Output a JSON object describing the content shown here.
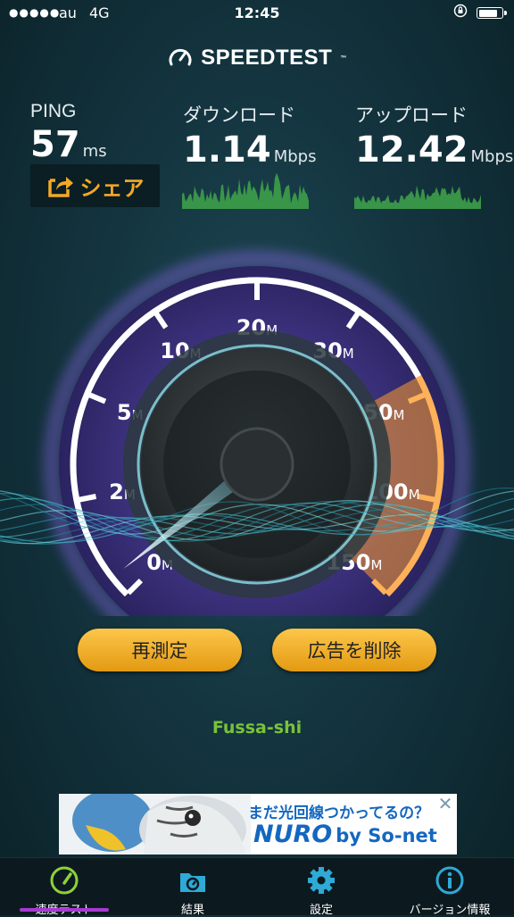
{
  "status_bar": {
    "signal": "●●●●●",
    "carrier": "au",
    "network": "4G",
    "time": "12:45",
    "lock_icon": "orientation-lock-icon",
    "battery_level": 0.8
  },
  "header": {
    "title": "SPEEDTEST",
    "trademark": "™"
  },
  "metrics": {
    "ping": {
      "label": "PING",
      "value": "57",
      "unit": "ms"
    },
    "download": {
      "label": "ダウンロード",
      "value": "1.14",
      "unit": "Mbps"
    },
    "upload": {
      "label": "アップロード",
      "value": "12.42",
      "unit": "Mbps"
    }
  },
  "share_button": {
    "label": "シェア",
    "icon": "share-icon"
  },
  "gauge": {
    "scale_labels": [
      {
        "num": "0",
        "unit": "M"
      },
      {
        "num": "2",
        "unit": "M"
      },
      {
        "num": "5",
        "unit": "M"
      },
      {
        "num": "10",
        "unit": "M"
      },
      {
        "num": "20",
        "unit": "M"
      },
      {
        "num": "30",
        "unit": "M"
      },
      {
        "num": "50",
        "unit": "M"
      },
      {
        "num": "100",
        "unit": "M"
      },
      {
        "num": "150",
        "unit": "M"
      }
    ],
    "colors": {
      "download_arc": "#ffffff",
      "glow": "#9b6cff",
      "upload_arc": "#ff9d2e",
      "needle": "#9de8f2"
    }
  },
  "actions": {
    "retest_label": "再測定",
    "remove_ads_label": "広告を削除"
  },
  "location": "Fussa-shi",
  "ad": {
    "headline": "まだ光回線つかってるの？",
    "brand": "NURO",
    "by": "by So-net",
    "close_icon": "close-icon"
  },
  "tabs": [
    {
      "label": "速度テスト",
      "icon": "speedometer-icon",
      "active": true
    },
    {
      "label": "結果",
      "icon": "results-folder-icon",
      "active": false
    },
    {
      "label": "設定",
      "icon": "gear-icon",
      "active": false
    },
    {
      "label": "バージョン情報",
      "icon": "info-icon",
      "active": false
    }
  ],
  "accent_colors": {
    "share": "#f4a826",
    "button": "#f2b234",
    "location": "#7ac23a",
    "active_tab": "#a63bd0"
  }
}
